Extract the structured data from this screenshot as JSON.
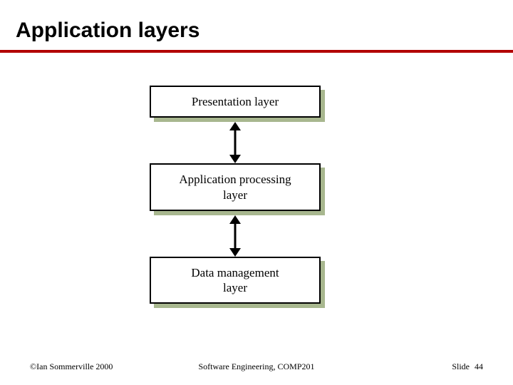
{
  "title": "Application layers",
  "layers": [
    {
      "text": "Presentation layer"
    },
    {
      "text": "Application processing\nlayer"
    },
    {
      "text": "Data management\nlayer"
    }
  ],
  "footer": {
    "left": "©Ian Sommerville 2000",
    "center": "Software Engineering, COMP201",
    "right_label": "Slide ",
    "right_number": "44"
  }
}
